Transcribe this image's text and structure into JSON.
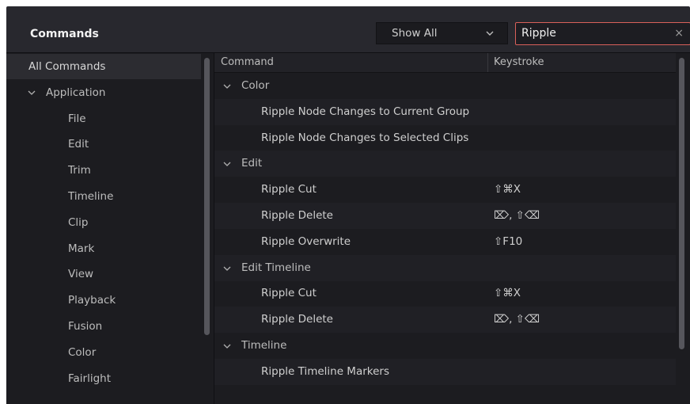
{
  "header": {
    "title": "Commands",
    "filter": {
      "selected": "Show All",
      "icon": "chevron-down-icon"
    },
    "search": {
      "value": "Ripple",
      "clear_icon": "close-icon",
      "clear_glyph": "×"
    }
  },
  "sidebar": {
    "items": [
      {
        "label": "All Commands",
        "selected": true
      },
      {
        "label": "Application",
        "expanded": true
      },
      {
        "label": "File"
      },
      {
        "label": "Edit"
      },
      {
        "label": "Trim"
      },
      {
        "label": "Timeline"
      },
      {
        "label": "Clip"
      },
      {
        "label": "Mark"
      },
      {
        "label": "View"
      },
      {
        "label": "Playback"
      },
      {
        "label": "Fusion"
      },
      {
        "label": "Color"
      },
      {
        "label": "Fairlight"
      }
    ]
  },
  "table": {
    "columns": [
      "Command",
      "Keystroke"
    ],
    "groups": [
      {
        "label": "Color",
        "rows": [
          {
            "command": "Ripple Node Changes to Current Group",
            "keystroke": ""
          },
          {
            "command": "Ripple Node Changes to Selected Clips",
            "keystroke": ""
          }
        ]
      },
      {
        "label": "Edit",
        "rows": [
          {
            "command": "Ripple Cut",
            "keystroke": "⇧⌘X"
          },
          {
            "command": "Ripple Delete",
            "keystroke": "⌦, ⇧⌫"
          },
          {
            "command": "Ripple Overwrite",
            "keystroke": "⇧F10"
          }
        ]
      },
      {
        "label": "Edit Timeline",
        "rows": [
          {
            "command": "Ripple Cut",
            "keystroke": "⇧⌘X"
          },
          {
            "command": "Ripple Delete",
            "keystroke": "⌦, ⇧⌫"
          }
        ]
      },
      {
        "label": "Timeline",
        "rows": [
          {
            "command": "Ripple Timeline Markers",
            "keystroke": ""
          }
        ]
      }
    ]
  },
  "colors": {
    "window_bg": "#28282e",
    "panel_bg": "#1c1c20",
    "search_border": "#d9605a",
    "text": "#c8c8c8"
  }
}
